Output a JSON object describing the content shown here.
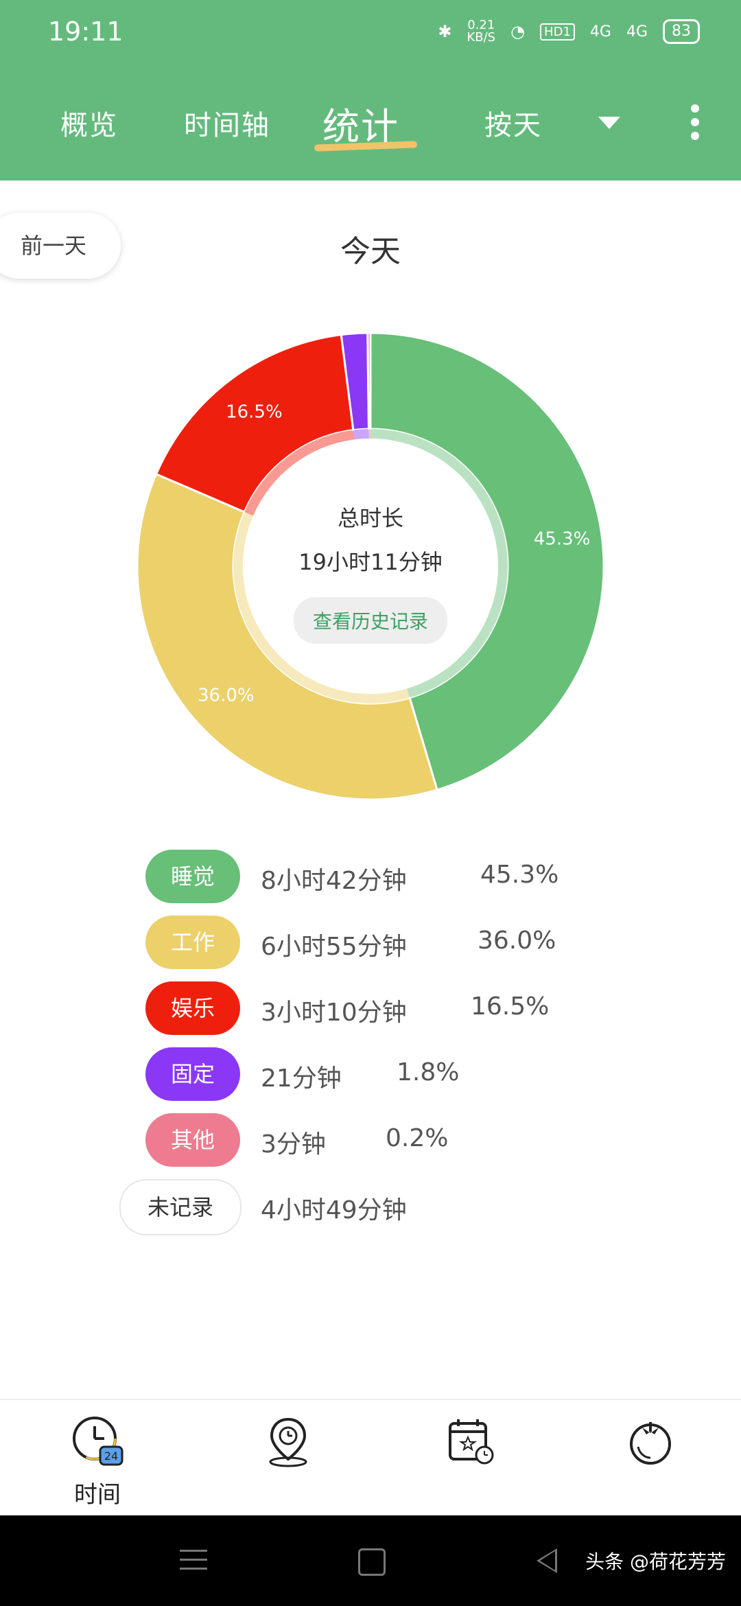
{
  "status_bar": {
    "time": "19:11",
    "net_speed": "0.21\nKB/S",
    "hd": "HD1",
    "sig1": "4G",
    "sig2": "4G",
    "battery": "83"
  },
  "nav": {
    "tabs": [
      "概览",
      "时间轴",
      "统计",
      "按天"
    ],
    "active_tab": "统计"
  },
  "day_nav": {
    "prev_label": "前一天",
    "title": "今天"
  },
  "summary": {
    "title": "总时长",
    "value": "19小时11分钟",
    "history_button": "查看历史记录"
  },
  "chart_data": {
    "type": "pie",
    "donut": true,
    "categories": [
      "睡觉",
      "工作",
      "娱乐",
      "固定",
      "其他"
    ],
    "values": [
      45.3,
      36.0,
      16.5,
      1.8,
      0.2
    ],
    "labels": [
      "45.3%",
      "36.0%",
      "16.5%",
      "",
      ""
    ],
    "colors": [
      "#67bf78",
      "#ecd06a",
      "#ef1f0e",
      "#8a38f5",
      "#ee7b8f"
    ]
  },
  "legend": [
    {
      "name": "睡觉",
      "duration": "8小时42分钟",
      "percent": "45.3%",
      "color": "#67bf78"
    },
    {
      "name": "工作",
      "duration": "6小时55分钟",
      "percent": "36.0%",
      "color": "#ecd06a"
    },
    {
      "name": "娱乐",
      "duration": "3小时10分钟",
      "percent": "16.5%",
      "color": "#ef1f0e"
    },
    {
      "name": "固定",
      "duration": "21分钟",
      "percent": "1.8%",
      "color": "#8a38f5"
    },
    {
      "name": "其他",
      "duration": "3分钟",
      "percent": "0.2%",
      "color": "#ee7b8f"
    },
    {
      "name": "未记录",
      "duration": "4小时49分钟",
      "percent": ""
    }
  ],
  "bottom_nav": {
    "time_label": "时间",
    "time_badge": "24"
  },
  "watermark": "头条 @荷花芳芳"
}
